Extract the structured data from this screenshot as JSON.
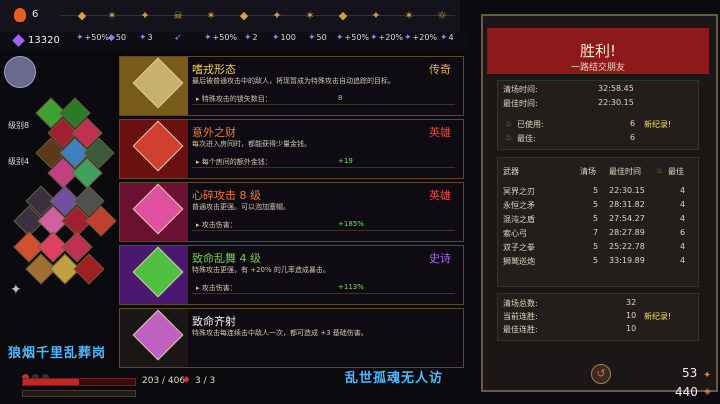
{
  "top": {
    "darkness": "6",
    "gems": "13320"
  },
  "stats": [
    {
      "glyph": "✦",
      "value": "+50%"
    },
    {
      "glyph": "◆",
      "value": "50"
    },
    {
      "glyph": "✦",
      "value": "3"
    },
    {
      "glyph": "➶",
      "value": ""
    },
    {
      "glyph": "✦",
      "value": "+50%"
    },
    {
      "glyph": "✦",
      "value": "2"
    },
    {
      "glyph": "✦",
      "value": "100"
    },
    {
      "glyph": "✦",
      "value": "50"
    },
    {
      "glyph": "✦",
      "value": "+50%"
    },
    {
      "glyph": "✦",
      "value": "+20%"
    },
    {
      "glyph": "✦",
      "value": "+20%"
    },
    {
      "glyph": "✦",
      "value": "4"
    }
  ],
  "left": {
    "level1": "级别8",
    "level2": "级别4"
  },
  "boons": [
    {
      "title": "嗜戎形态",
      "rarity": "传奇",
      "desc": "最后被普通攻击中的敌人，将现暂成为特殊攻击自动追踪的目标。",
      "sub": "▸ 特殊攻击的锁矢数目：",
      "val": "8",
      "title_color": "#f2d060",
      "rarity_color": "#e8b040",
      "band": "#7a5a18",
      "art": "#c8b070"
    },
    {
      "title": "意外之财",
      "rarity": "英雄",
      "desc": "每次进入房间时，都能获得少量金钱。",
      "sub": "▸ 每个房间的额外金钱：",
      "val": "+19",
      "title_color": "#f07a3a",
      "rarity_color": "#e84a3a",
      "band": "#6a1010",
      "art": "#d04030"
    },
    {
      "title": "心碎攻击 8 级",
      "rarity": "英雄",
      "desc": "普通攻击更强。可以泡加塞帽。",
      "sub": "▸ 攻击伤害：",
      "val": "+185%",
      "title_color": "#f07a3a",
      "rarity_color": "#e84a3a",
      "band": "#6a1030",
      "art": "#e050a0"
    },
    {
      "title": "致命乱舞 4 级",
      "rarity": "史诗",
      "desc": "特殊攻击更强，有 +20% 的几率造成暴击。",
      "sub": "▸ 攻击伤害：",
      "val": "+113%",
      "title_color": "#70d048",
      "rarity_color": "#b060f0",
      "band": "#4a1870",
      "art": "#50c040"
    },
    {
      "title": "致命齐射",
      "rarity": "",
      "desc": "特殊攻击每连续击中敌人一次，都可造成 +3 基础伤害。",
      "sub": "",
      "val": "",
      "title_color": "#f0f0f0",
      "rarity_color": "#f0f0f0",
      "band": "#1a1616",
      "art": "#c060c0"
    }
  ],
  "names": {
    "left": "狼烟千里乱葬岗",
    "right": "乱世孤魂无人访"
  },
  "health": {
    "current": "203 / 406",
    "deaths": "3 / 3",
    "fraction": 0.5
  },
  "panel": {
    "title": "胜利!",
    "subtitle": "一路结交朋友",
    "clear_time_label": "清场时间:",
    "clear_time": "32:58.45",
    "best_time_label": "最佳时间:",
    "best_time": "22:30.15",
    "used_label": "已使用:",
    "used": "6",
    "used_new": "新纪录!",
    "best_label": "最佳:",
    "best": "6",
    "columns": [
      "武器",
      "清场",
      "最佳时间",
      "最佳"
    ],
    "weapons": [
      {
        "name": "冥界之刃",
        "clears": "5",
        "time": "22:30.15",
        "best": "4"
      },
      {
        "name": "永恒之矛",
        "clears": "5",
        "time": "28:31.82",
        "best": "4"
      },
      {
        "name": "混沌之盾",
        "clears": "5",
        "time": "27:54.27",
        "best": "4"
      },
      {
        "name": "索心弓",
        "clears": "7",
        "time": "28:27.89",
        "best": "6"
      },
      {
        "name": "双子之拳",
        "clears": "5",
        "time": "25:22.78",
        "best": "4"
      },
      {
        "name": "狮鹫巡炮",
        "clears": "5",
        "time": "33:19.89",
        "best": "4"
      }
    ],
    "total_label": "清场总数:",
    "total": "32",
    "streak_label": "当前连胜:",
    "streak": "10",
    "streak_new": "新纪录!",
    "best_streak_label": "最佳连胜:",
    "best_streak": "10"
  },
  "bottom": {
    "num1": "53",
    "num2": "440"
  }
}
